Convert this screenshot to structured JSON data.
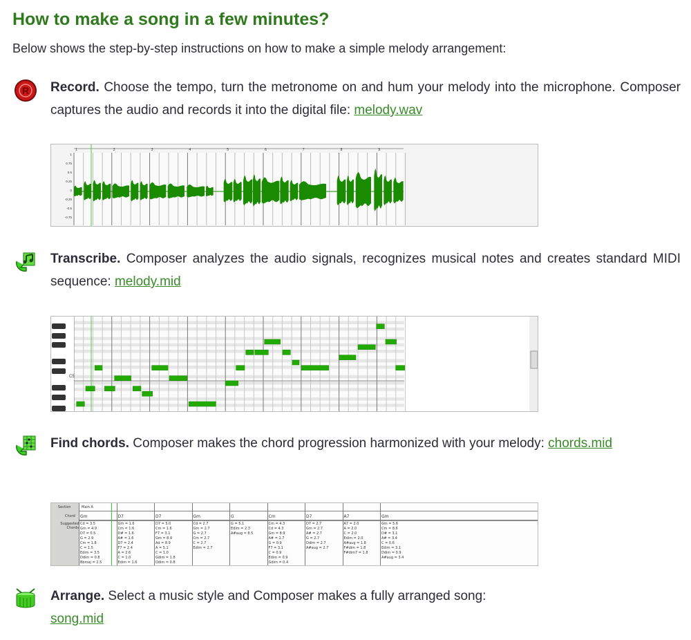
{
  "title": "How to make a song in a few minutes?",
  "intro": "Below shows the step-by-step instructions on how to make a simple melody arrangement:",
  "steps": [
    {
      "icon": "record-icon",
      "heading": "Record.",
      "text": " Choose the tempo, turn the metronome on and hum your melody into the microphone. Composer captures the audio and records it into the digital file: ",
      "link": "melody.wav"
    },
    {
      "icon": "transcribe-icon",
      "heading": "Transcribe.",
      "text": " Composer analyzes the audio signals, recognizes musical notes and creates standard MIDI sequence: ",
      "link": "melody.mid"
    },
    {
      "icon": "find-chords-icon",
      "heading": "Find chords.",
      "text": " Composer makes the chord progression harmonized with your melody: ",
      "link": "chords.mid"
    },
    {
      "icon": "arrange-drum-icon",
      "heading": "Arrange.",
      "text": " Select a music style and Composer makes a fully arranged song: ",
      "link": "song.mid"
    }
  ],
  "waveform": {
    "y_ticks": [
      "1",
      "0.75",
      "0.5",
      "0.25",
      "0",
      "-0.25",
      "-0.5",
      "-0.75"
    ],
    "bar_numbers": [
      "1",
      "2",
      "3",
      "4",
      "5",
      "6",
      "7",
      "8",
      "9"
    ],
    "color": "#1a8a00"
  },
  "piano_roll": {
    "c_label": "C5",
    "note_color": "#22aa00"
  },
  "chord_table": {
    "section_label": "Section",
    "section_value": "Main A",
    "chord_label": "Chord",
    "suggested_label": "Suggested Chords",
    "chords": [
      "Gm",
      "D7",
      "D7",
      "Gm",
      "G",
      "Cm",
      "D7",
      "A7",
      "Gm"
    ],
    "suggested": [
      [
        "Cd = 3.5",
        "Gm = 4.9",
        "D7 = 0.5",
        "G = 2.9",
        "Cm = 1.8",
        "C = 1.5",
        "Edim = 3.5",
        "Ddim = 0.8",
        "Bbmaj = 2.5"
      ],
      [
        "Gm = 1.6",
        "Cm = 1.6",
        "D# = 1.6",
        "A# = 1.6",
        "D7 = 2.4",
        "F7 = 2.4",
        "A = 2.6",
        "C = 1.0",
        "Edim = 1.6"
      ],
      [
        "D7 = 5.0",
        "Cm = 1.6",
        "F7 = 3.1",
        "Gm = 8.9",
        "Ad = 8.9",
        "A = 5.1",
        "C = 1.0",
        "Gdim = 1.8",
        "Ddim = 0.8"
      ],
      [
        "Cd = 2.7",
        "Gm = 2.7",
        "G = 2.7",
        "Cm = 2.7",
        "C = 2.7",
        "Edim = 2.7"
      ],
      [
        "G = 5.1",
        "Edim = 2.3",
        "A#aug = 8.5"
      ],
      [
        "Cm = 4.3",
        "Cd = 4.3",
        "Gm = 8.9",
        "A# = 1.7",
        "G = 0.9",
        "F7 = 3.1",
        "C = 0.9",
        "Edim = 0.9",
        "Gdim = 0.4"
      ],
      [
        "D7 = 2.7",
        "Gm = 2.7",
        "A# = 2.7",
        "G = 2.7",
        "Ddim = 2.7",
        "A#aug = 2.7"
      ],
      [
        "A7 = 2.0",
        "A = 2.0",
        "C = 2.0",
        "Edim = 2.0",
        "A#aug = 1.8",
        "F#dim = 1.8",
        "F#dim7 = 1.8"
      ],
      [
        "Gm = 5.6",
        "Cm = 8.6",
        "D# = 3.1",
        "A# = 3.4",
        "C = 0.6",
        "Edim = 3.1",
        "Ddim = 0.9",
        "A#aug = 3.4"
      ]
    ]
  }
}
